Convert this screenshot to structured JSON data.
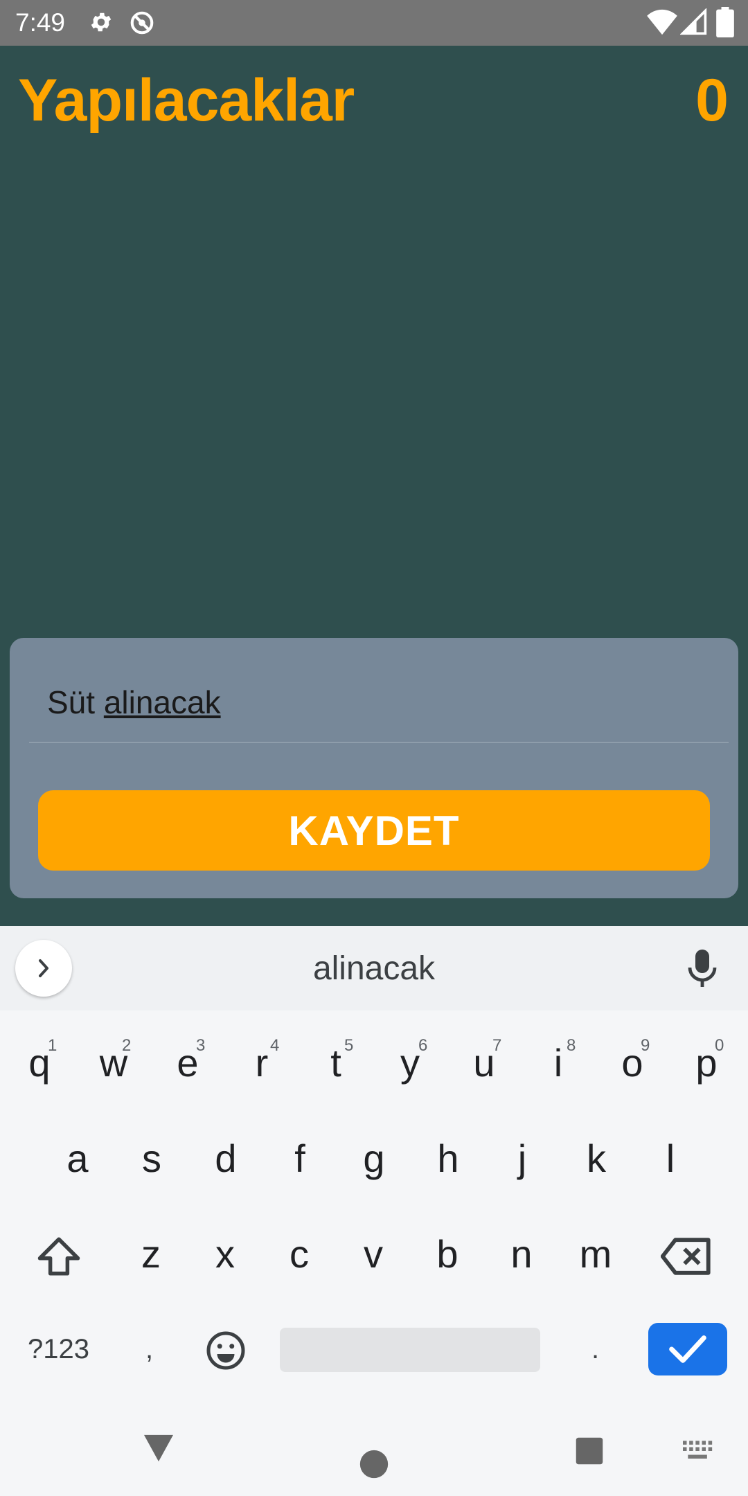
{
  "status_bar": {
    "time": "7:49"
  },
  "app": {
    "title": "Yapılacaklar",
    "count": "0",
    "input": {
      "value_prefix": "Süt ",
      "value_composing": "alinacak"
    },
    "save_button": "KAYDET"
  },
  "keyboard": {
    "suggestion": "alinacak",
    "row1": [
      {
        "k": "q",
        "h": "1"
      },
      {
        "k": "w",
        "h": "2"
      },
      {
        "k": "e",
        "h": "3"
      },
      {
        "k": "r",
        "h": "4"
      },
      {
        "k": "t",
        "h": "5"
      },
      {
        "k": "y",
        "h": "6"
      },
      {
        "k": "u",
        "h": "7"
      },
      {
        "k": "i",
        "h": "8"
      },
      {
        "k": "o",
        "h": "9"
      },
      {
        "k": "p",
        "h": "0"
      }
    ],
    "row2": [
      "a",
      "s",
      "d",
      "f",
      "g",
      "h",
      "j",
      "k",
      "l"
    ],
    "row3": [
      "z",
      "x",
      "c",
      "v",
      "b",
      "n",
      "m"
    ],
    "symbols_key": "?123",
    "comma_key": ",",
    "period_key": "."
  },
  "colors": {
    "background": "#2f4f4e",
    "accent": "#ffa500",
    "card": "#778899",
    "enter_key": "#1a73e8"
  }
}
